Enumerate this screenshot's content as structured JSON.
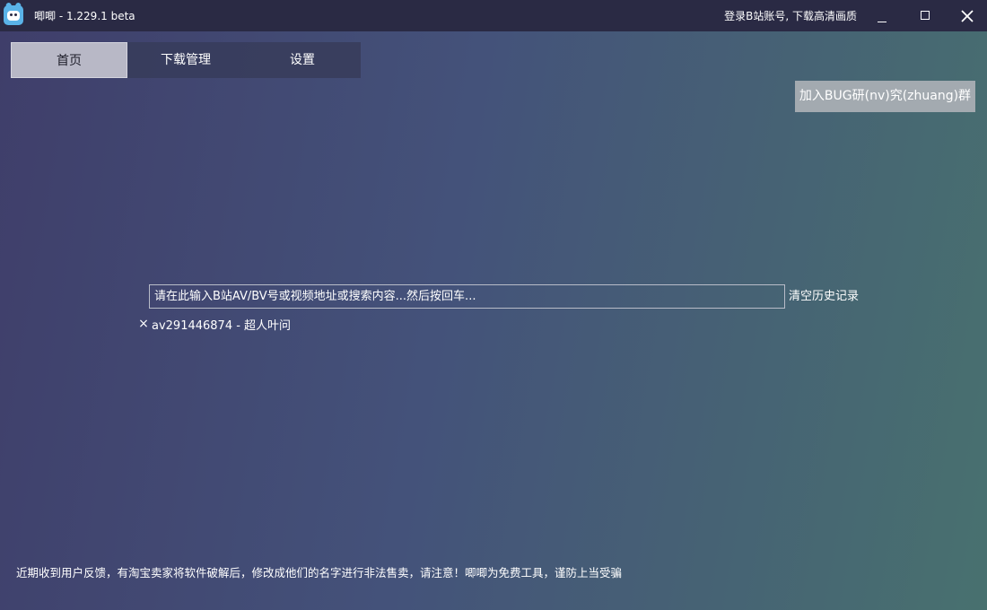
{
  "window": {
    "title": "唧唧 - 1.229.1 beta",
    "login_link": "登录B站账号, 下载高清画质",
    "minimize_glyph": "_",
    "maximize_glyph": "□",
    "close_glyph": "✕"
  },
  "tabs": [
    {
      "label": "首页",
      "active": true
    },
    {
      "label": "下载管理",
      "active": false
    },
    {
      "label": "设置",
      "active": false
    }
  ],
  "join_button": {
    "label": "加入BUG研(nv)究(zhuang)群"
  },
  "search": {
    "placeholder": "请在此输入B站AV/BV号或视频地址或搜索内容...然后按回车...",
    "value": "",
    "clear_history_label": "清空历史记录"
  },
  "history": [
    {
      "remove_glyph": "×",
      "text": "av291446874 - 超人叶问"
    }
  ],
  "notice": "近期收到用户反馈，有淘宝卖家将软件破解后，修改成他们的名字进行非法售卖，请注意！唧唧为免费工具，谨防上当受骗",
  "colors": {
    "titlebar": "#2a2a44",
    "active_tab_bg": "#b8b8c6",
    "join_button_bg": "#a3aab0",
    "logo": "#5ab3e8"
  },
  "icons": {
    "app_logo": "cat-logo-icon",
    "minimize": "minimize-icon",
    "maximize": "maximize-icon",
    "close": "close-icon",
    "history_remove": "remove-icon"
  }
}
